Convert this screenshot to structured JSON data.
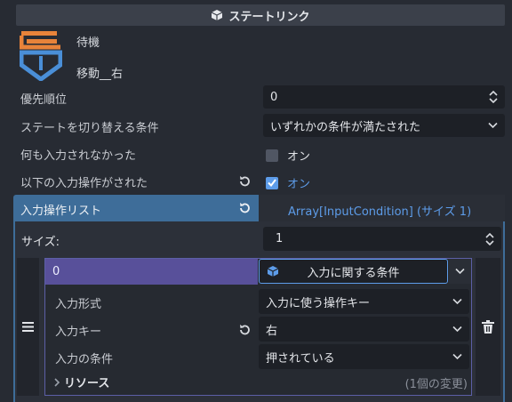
{
  "header": {
    "title": "ステートリンク",
    "icon": "cube-icon"
  },
  "transition": {
    "from": "待機",
    "to": "移動__右",
    "logo": "transition-logo-icon"
  },
  "properties": {
    "priority": {
      "label": "優先順位",
      "value": "0"
    },
    "switch_condition": {
      "label": "ステートを切り替える条件",
      "value": "いずれかの条件が満たされた"
    },
    "no_input": {
      "label": "何も入力されなかった",
      "checked": false,
      "value": "オン"
    },
    "input_performed": {
      "label": "以下の入力操作がされた",
      "checked": true,
      "value": "オン"
    }
  },
  "input_list": {
    "label": "入力操作リスト",
    "type_value": "Array[InputCondition] (サイズ 1)",
    "size_label": "サイズ:",
    "size_value": "1",
    "element": {
      "index": "0",
      "type_button": "入力に関する条件",
      "fields": [
        {
          "label": "入力形式",
          "value": "入力に使う操作キー"
        },
        {
          "label": "入力キー",
          "value": "右"
        },
        {
          "label": "入力の条件",
          "value": "押されている"
        }
      ],
      "resource_label": "リソース",
      "change_count": "(1個の変更)"
    }
  },
  "colors": {
    "accent": "#5d9ce9",
    "section": "#3e6d99",
    "element": "#58509a",
    "background": "#272b33"
  }
}
